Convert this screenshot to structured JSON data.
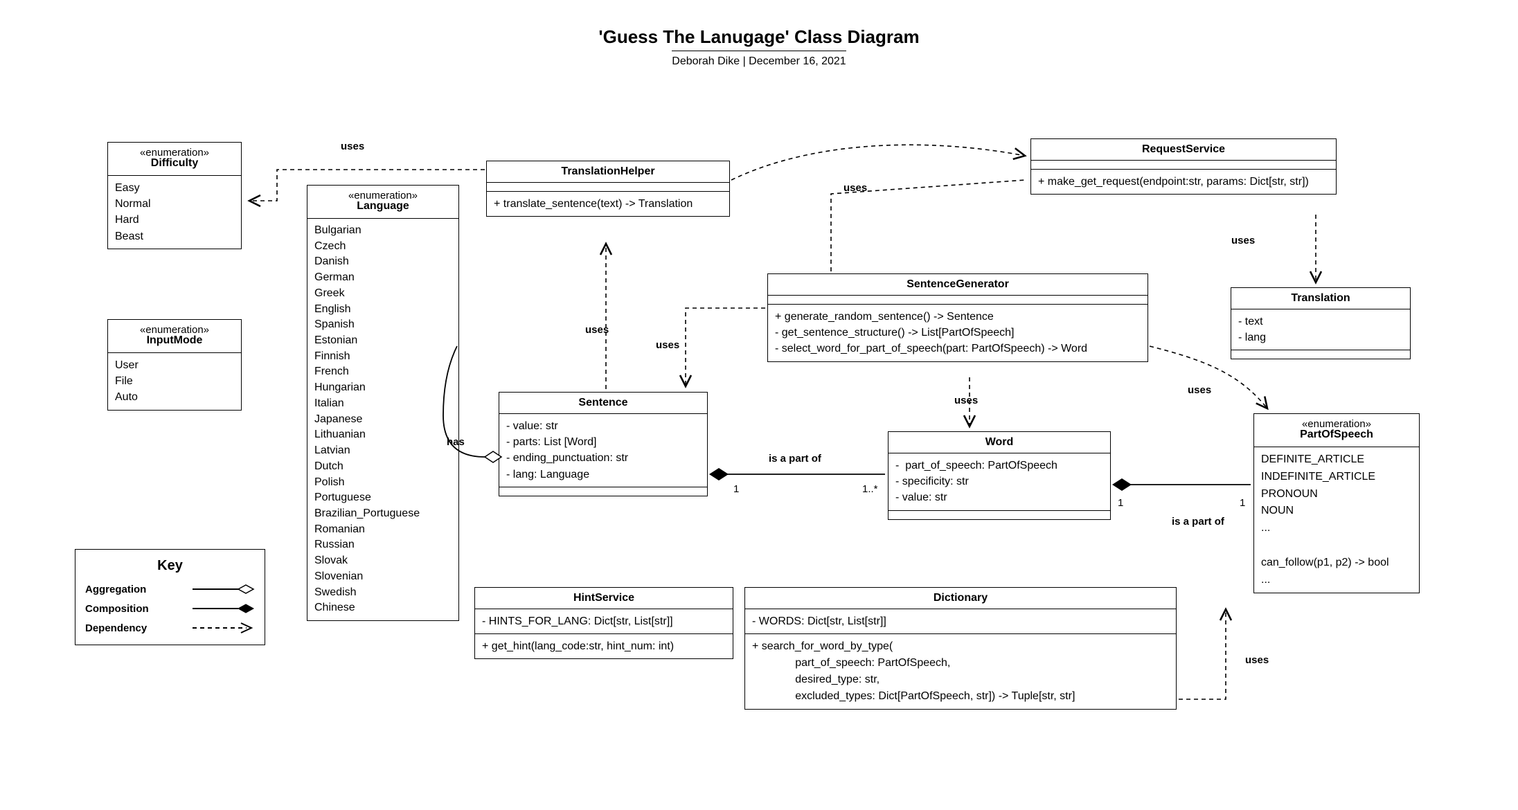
{
  "title": "'Guess The Lanugage' Class Diagram",
  "subtitle": "Deborah Dike  |  December 16, 2021",
  "difficulty": {
    "stereo": "«enumeration»",
    "name": "Difficulty",
    "items": "Easy\nNormal\nHard\nBeast"
  },
  "inputMode": {
    "stereo": "«enumeration»",
    "name": "InputMode",
    "items": "User\nFile\nAuto"
  },
  "language": {
    "stereo": "«enumeration»",
    "name": "Language",
    "items": "Bulgarian\nCzech\nDanish\nGerman\nGreek\nEnglish\nSpanish\nEstonian\nFinnish\nFrench\nHungarian\nItalian\nJapanese\nLithuanian\nLatvian\nDutch\nPolish\nPortuguese\nBrazilian_Portuguese\nRomanian\nRussian\nSlovak\nSlovenian\nSwedish\nChinese"
  },
  "translationHelper": {
    "name": "TranslationHelper",
    "methods": "+ translate_sentence(text) -> Translation"
  },
  "requestService": {
    "name": "RequestService",
    "methods": "+ make_get_request(endpoint:str, params: Dict[str, str])"
  },
  "sentenceGenerator": {
    "name": "SentenceGenerator",
    "methods": "+ generate_random_sentence() -> Sentence\n- get_sentence_structure() -> List[PartOfSpeech]\n- select_word_for_part_of_speech(part: PartOfSpeech) -> Word"
  },
  "translation": {
    "name": "Translation",
    "attrs": "- text\n- lang"
  },
  "sentence": {
    "name": "Sentence",
    "attrs": "- value: str\n- parts: List [Word]\n- ending_punctuation: str\n- lang: Language"
  },
  "word": {
    "name": "Word",
    "attrs": "-  part_of_speech: PartOfSpeech\n- specificity: str\n- value: str"
  },
  "partOfSpeech": {
    "stereo": "«enumeration»",
    "name": "PartOfSpeech",
    "items": "DEFINITE_ARTICLE\nINDEFINITE_ARTICLE\nPRONOUN\nNOUN\n...\n\ncan_follow(p1, p2) -> bool\n..."
  },
  "hintService": {
    "name": "HintService",
    "attrs": "- HINTS_FOR_LANG: Dict[str, List[str]]",
    "methods": "+ get_hint(lang_code:str, hint_num: int)"
  },
  "dictionary": {
    "name": "Dictionary",
    "attrs": "- WORDS: Dict[str, List[str]]",
    "methods": "+ search_for_word_by_type(\n              part_of_speech: PartOfSpeech,\n              desired_type: str,\n              excluded_types: Dict[PartOfSpeech, str]) -> Tuple[str, str]"
  },
  "key": {
    "title": "Key",
    "agg": "Aggregation",
    "comp": "Composition",
    "dep": "Dependency"
  },
  "labels": {
    "uses": "uses",
    "isPartOf": "is a part of",
    "has": "has",
    "one": "1",
    "oneMany": "1..*"
  }
}
